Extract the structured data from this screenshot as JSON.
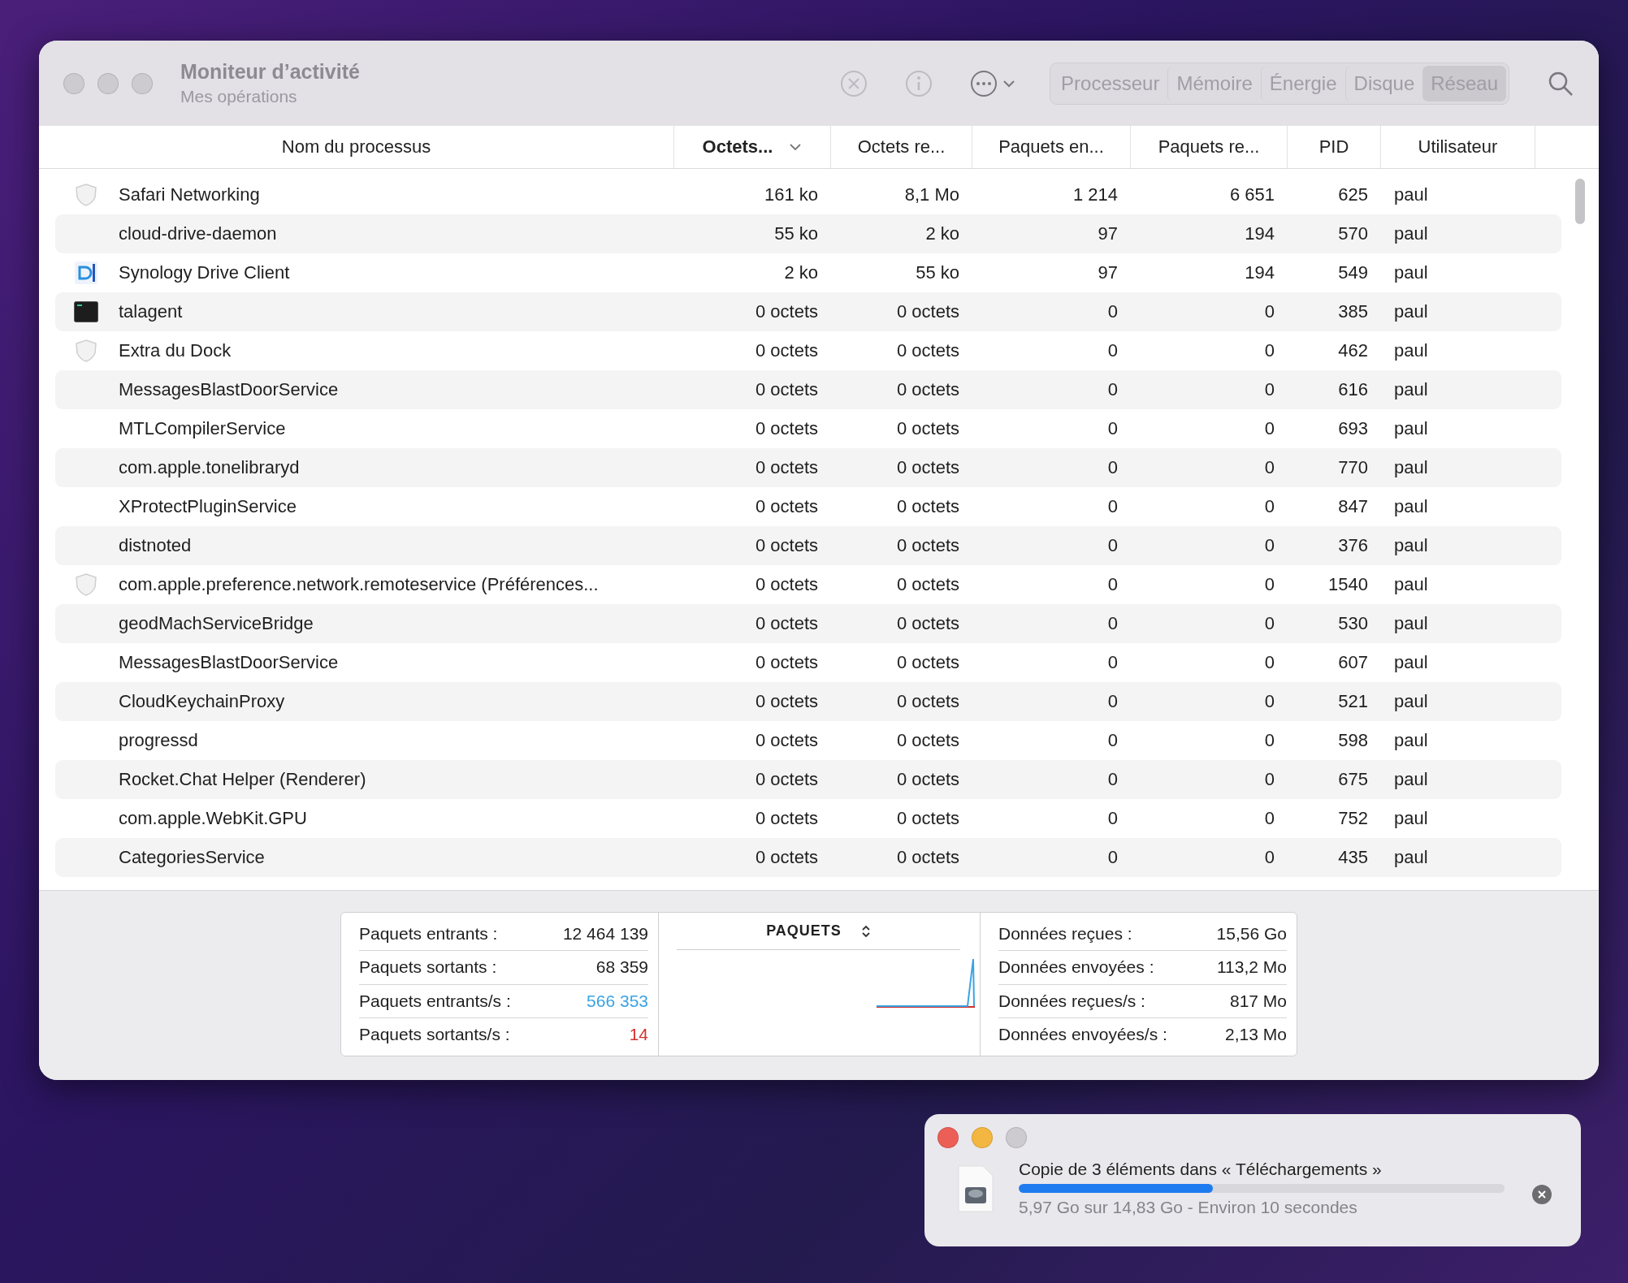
{
  "window": {
    "title": "Moniteur d’activité",
    "subtitle": "Mes opérations"
  },
  "tabs": [
    {
      "label": "Processeur",
      "selected": false
    },
    {
      "label": "Mémoire",
      "selected": false
    },
    {
      "label": "Énergie",
      "selected": false
    },
    {
      "label": "Disque",
      "selected": false
    },
    {
      "label": "Réseau",
      "selected": true
    }
  ],
  "table": {
    "columns": [
      {
        "label": "Nom du processus",
        "sorted": false
      },
      {
        "label": "Octets...",
        "sorted": true
      },
      {
        "label": "Octets re...",
        "sorted": false
      },
      {
        "label": "Paquets en...",
        "sorted": false
      },
      {
        "label": "Paquets re...",
        "sorted": false
      },
      {
        "label": "PID",
        "sorted": false
      },
      {
        "label": "Utilisateur",
        "sorted": false
      }
    ],
    "rows": [
      {
        "kind": "shield",
        "cells": [
          "Safari Networking",
          "161 ko",
          "8,1 Mo",
          "1 214",
          "6 651",
          "625",
          "paul"
        ]
      },
      {
        "kind": "plain",
        "cells": [
          "cloud-drive-daemon",
          "55 ko",
          "2 ko",
          "97",
          "194",
          "570",
          "paul"
        ]
      },
      {
        "kind": "drive",
        "cells": [
          "Synology Drive Client",
          "2 ko",
          "55 ko",
          "97",
          "194",
          "549",
          "paul"
        ]
      },
      {
        "kind": "terminal",
        "cells": [
          "talagent",
          "0 octets",
          "0 octets",
          "0",
          "0",
          "385",
          "paul"
        ]
      },
      {
        "kind": "shield",
        "cells": [
          "Extra du Dock",
          "0 octets",
          "0 octets",
          "0",
          "0",
          "462",
          "paul"
        ]
      },
      {
        "kind": "plain",
        "cells": [
          "MessagesBlastDoorService",
          "0 octets",
          "0 octets",
          "0",
          "0",
          "616",
          "paul"
        ]
      },
      {
        "kind": "plain",
        "cells": [
          "MTLCompilerService",
          "0 octets",
          "0 octets",
          "0",
          "0",
          "693",
          "paul"
        ]
      },
      {
        "kind": "plain",
        "cells": [
          "com.apple.tonelibraryd",
          "0 octets",
          "0 octets",
          "0",
          "0",
          "770",
          "paul"
        ]
      },
      {
        "kind": "plain",
        "cells": [
          "XProtectPluginService",
          "0 octets",
          "0 octets",
          "0",
          "0",
          "847",
          "paul"
        ]
      },
      {
        "kind": "plain",
        "cells": [
          "distnoted",
          "0 octets",
          "0 octets",
          "0",
          "0",
          "376",
          "paul"
        ]
      },
      {
        "kind": "shield",
        "cells": [
          "com.apple.preference.network.remoteservice (Préférences...",
          "0 octets",
          "0 octets",
          "0",
          "0",
          "1540",
          "paul"
        ]
      },
      {
        "kind": "plain",
        "cells": [
          "geodMachServiceBridge",
          "0 octets",
          "0 octets",
          "0",
          "0",
          "530",
          "paul"
        ]
      },
      {
        "kind": "plain",
        "cells": [
          "MessagesBlastDoorService",
          "0 octets",
          "0 octets",
          "0",
          "0",
          "607",
          "paul"
        ]
      },
      {
        "kind": "plain",
        "cells": [
          "CloudKeychainProxy",
          "0 octets",
          "0 octets",
          "0",
          "0",
          "521",
          "paul"
        ]
      },
      {
        "kind": "plain",
        "cells": [
          "progressd",
          "0 octets",
          "0 octets",
          "0",
          "0",
          "598",
          "paul"
        ]
      },
      {
        "kind": "plain",
        "cells": [
          "Rocket.Chat Helper (Renderer)",
          "0 octets",
          "0 octets",
          "0",
          "0",
          "675",
          "paul"
        ]
      },
      {
        "kind": "plain",
        "cells": [
          "com.apple.WebKit.GPU",
          "0 octets",
          "0 octets",
          "0",
          "0",
          "752",
          "paul"
        ]
      },
      {
        "kind": "plain",
        "cells": [
          "CategoriesService",
          "0 octets",
          "0 octets",
          "0",
          "0",
          "435",
          "paul"
        ]
      }
    ]
  },
  "stats": {
    "left": [
      {
        "label": "Paquets entrants :",
        "value": "12 464 139",
        "color": "#1e1e1e"
      },
      {
        "label": "Paquets sortants :",
        "value": "68 359",
        "color": "#1e1e1e"
      },
      {
        "label": "Paquets entrants/s :",
        "value": "566 353",
        "color": "#3aa3e3"
      },
      {
        "label": "Paquets sortants/s :",
        "value": "14",
        "color": "#d2312b"
      }
    ],
    "chart_title": "PAQUETS",
    "right": [
      {
        "label": "Données reçues :",
        "value": "15,56 Go"
      },
      {
        "label": "Données envoyées :",
        "value": "113,2 Mo"
      },
      {
        "label": "Données reçues/s :",
        "value": "817 Mo"
      },
      {
        "label": "Données envoyées/s :",
        "value": "2,13 Mo"
      }
    ]
  },
  "copy_dialog": {
    "title": "Copie de 3 éléments dans « Téléchargements »",
    "level": 0.4,
    "status": "5,97 Go sur 14,83 Go - Environ 10 secondes"
  }
}
